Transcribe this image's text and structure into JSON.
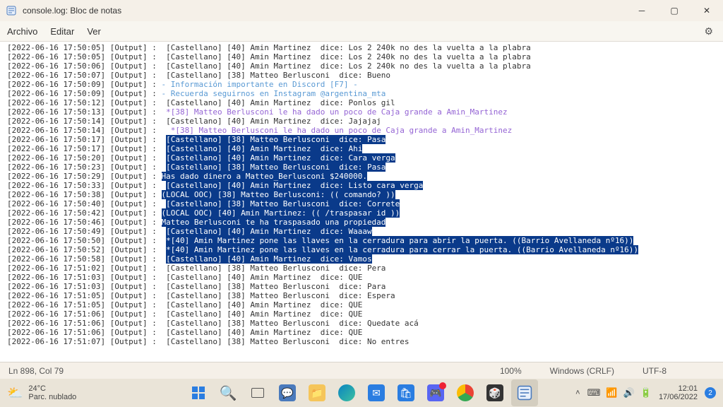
{
  "window": {
    "title": "console.log: Bloc de notas"
  },
  "menu": {
    "file": "Archivo",
    "edit": "Editar",
    "view": "Ver"
  },
  "status": {
    "pos": "Ln 898, Col 79",
    "zoom": "100%",
    "eol": "Windows (CRLF)",
    "enc": "UTF-8"
  },
  "weather": {
    "temp": "24°C",
    "desc": "Parc. nublado"
  },
  "clock": {
    "time": "12:01",
    "date": "17/06/2022"
  },
  "notif_count": "2",
  "lines": [
    {
      "sel": false,
      "prefix": "[2022-06-16 17:50:05] [Output] :  ",
      "rest": "[Castellano] [40] Amin Martinez  dice: Los 2 240k no des la vuelta a la plabra"
    },
    {
      "sel": false,
      "prefix": "[2022-06-16 17:50:05] [Output] :  ",
      "rest": "[Castellano] [40] Amin Martinez  dice: Los 2 240k no des la vuelta a la plabra"
    },
    {
      "sel": false,
      "prefix": "[2022-06-16 17:50:06] [Output] :  ",
      "rest": "[Castellano] [40] Amin Martinez  dice: Los 2 240k no des la vuelta a la plabra"
    },
    {
      "sel": false,
      "prefix": "[2022-06-16 17:50:07] [Output] :  ",
      "rest": "[Castellano] [38] Matteo Berlusconi  dice: Bueno"
    },
    {
      "sel": false,
      "prefix": "[2022-06-16 17:50:09] [Output] : ",
      "rest": "- Información importante en Discord [F7] -",
      "cls": "t-lightblue"
    },
    {
      "sel": false,
      "prefix": "[2022-06-16 17:50:09] [Output] : ",
      "rest": "- Recuerda seguirnos en Instagram @argentina_mta",
      "cls": "t-lightblue"
    },
    {
      "sel": false,
      "prefix": "[2022-06-16 17:50:12] [Output] :  ",
      "rest": "[Castellano] [40] Amin Martinez  dice: Ponlos gil"
    },
    {
      "sel": false,
      "prefix": "[2022-06-16 17:50:13] [Output] :  ",
      "rest": "*[38] Matteo Berlusconi le ha dado un poco de Caja grande a Amin_Martinez",
      "cls": "t-purple"
    },
    {
      "sel": false,
      "prefix": "[2022-06-16 17:50:14] [Output] :  ",
      "rest": "[Castellano] [40] Amin Martinez  dice: Jajajaj"
    },
    {
      "sel": false,
      "prefix": "[2022-06-16 17:50:14] [Output] :   ",
      "rest": "*[38] Matteo Berlusconi le ha dado un poco de Caja grande a Amin_Martinez",
      "cls": "t-purple"
    },
    {
      "sel": true,
      "prefix": "[2022-06-16 17:50:17] [Output] :  ",
      "rest": "[Castellano] [38] Matteo Berlusconi  dice: Pasa"
    },
    {
      "sel": true,
      "prefix": "[2022-06-16 17:50:17] [Output] :  ",
      "rest": "[Castellano] [40] Amin Martinez  dice: Ahi"
    },
    {
      "sel": true,
      "prefix": "[2022-06-16 17:50:20] [Output] :  ",
      "rest": "[Castellano] [40] Amin Martinez  dice: Cara verga"
    },
    {
      "sel": true,
      "prefix": "[2022-06-16 17:50:23] [Output] :  ",
      "rest": "[Castellano] [38] Matteo Berlusconi  dice: Pasa"
    },
    {
      "sel": true,
      "prefix": "[2022-06-16 17:50:29] [Output] : ",
      "rest": "Has dado dinero a Matteo_Berlusconi $240000.",
      "cls": "t-orange"
    },
    {
      "sel": true,
      "prefix": "[2022-06-16 17:50:33] [Output] :  ",
      "rest": "[Castellano] [40] Amin Martinez  dice: Listo cara verga"
    },
    {
      "sel": true,
      "prefix": "[2022-06-16 17:50:38] [Output] : ",
      "rest": "(LOCAL OOC) [38] Matteo Berlusconi: (( comando? ))",
      "cls": "t-lightblue"
    },
    {
      "sel": true,
      "prefix": "[2022-06-16 17:50:40] [Output] :  ",
      "rest": "[Castellano] [38] Matteo Berlusconi  dice: Correte"
    },
    {
      "sel": true,
      "prefix": "[2022-06-16 17:50:42] [Output] : ",
      "rest": "(LOCAL OOC) [40] Amin Martinez: (( /traspasar id ))",
      "cls": "t-lightblue"
    },
    {
      "sel": true,
      "prefix": "[2022-06-16 17:50:46] [Output] : ",
      "rest": "Matteo Berlusconi te ha traspasado una propiedad",
      "cls": "t-green"
    },
    {
      "sel": true,
      "prefix": "[2022-06-16 17:50:49] [Output] :  ",
      "rest": "[Castellano] [40] Amin Martinez  dice: Waaaw"
    },
    {
      "sel": true,
      "prefix": "[2022-06-16 17:50:50] [Output] :  ",
      "rest": "*[40] Amin Martinez pone las llaves en la cerradura para abrir la puerta. ((Barrio Avellaneda nº16))",
      "cls": "t-purple"
    },
    {
      "sel": true,
      "prefix": "[2022-06-16 17:50:52] [Output] :  ",
      "rest": "*[40] Amin Martinez pone las llaves en la cerradura para cerrar la puerta. ((Barrio Avellaneda nº16))",
      "cls": "t-purple"
    },
    {
      "sel": true,
      "prefix": "[2022-06-16 17:50:58] [Output] :  ",
      "rest": "[Castellano] [40] Amin Martinez  dice: Vamos"
    },
    {
      "sel": false,
      "prefix": "[2022-06-16 17:51:02] [Output] :  ",
      "rest": "[Castellano] [38] Matteo Berlusconi  dice: Pera"
    },
    {
      "sel": false,
      "prefix": "[2022-06-16 17:51:03] [Output] :  ",
      "rest": "[Castellano] [40] Amin Martinez  dice: QUE"
    },
    {
      "sel": false,
      "prefix": "[2022-06-16 17:51:03] [Output] :  ",
      "rest": "[Castellano] [38] Matteo Berlusconi  dice: Para"
    },
    {
      "sel": false,
      "prefix": "[2022-06-16 17:51:05] [Output] :  ",
      "rest": "[Castellano] [38] Matteo Berlusconi  dice: Espera"
    },
    {
      "sel": false,
      "prefix": "[2022-06-16 17:51:05] [Output] :  ",
      "rest": "[Castellano] [40] Amin Martinez  dice: QUE"
    },
    {
      "sel": false,
      "prefix": "[2022-06-16 17:51:06] [Output] :  ",
      "rest": "[Castellano] [40] Amin Martinez  dice: QUE"
    },
    {
      "sel": false,
      "prefix": "[2022-06-16 17:51:06] [Output] :  ",
      "rest": "[Castellano] [38] Matteo Berlusconi  dice: Quedate acá"
    },
    {
      "sel": false,
      "prefix": "[2022-06-16 17:51:06] [Output] :  ",
      "rest": "[Castellano] [40] Amin Martinez  dice: QUE"
    },
    {
      "sel": false,
      "prefix": "[2022-06-16 17:51:07] [Output] :  ",
      "rest": "[Castellano] [38] Matteo Berlusconi  dice: No entres"
    }
  ]
}
